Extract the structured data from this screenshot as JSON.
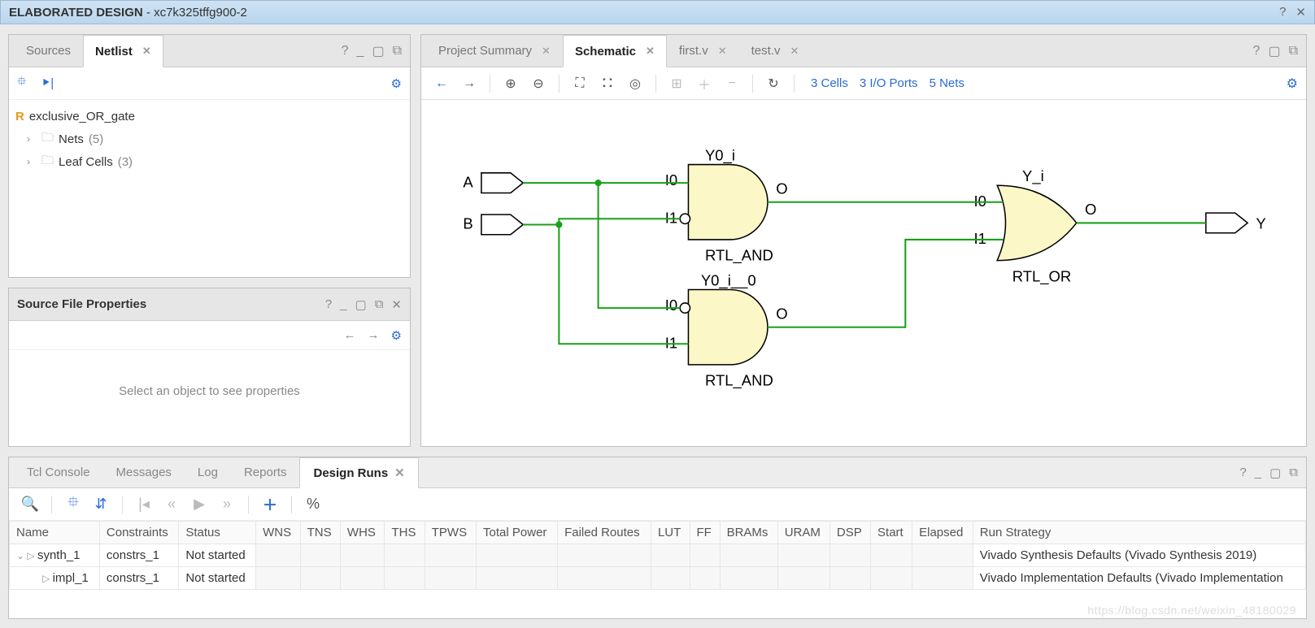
{
  "titlebar": {
    "label": "ELABORATED DESIGN",
    "subtitle": "xc7k325tffg900-2"
  },
  "left": {
    "tabs": {
      "sources": "Sources",
      "netlist": "Netlist"
    },
    "tree": {
      "root": "exclusive_OR_gate",
      "nets_label": "Nets",
      "nets_count": "(5)",
      "cells_label": "Leaf Cells",
      "cells_count": "(3)"
    },
    "props": {
      "title": "Source File Properties",
      "placeholder": "Select an object to see properties"
    }
  },
  "schematic": {
    "tabs": {
      "project": "Project Summary",
      "schematic": "Schematic",
      "first": "first.v",
      "test": "test.v"
    },
    "info": {
      "cells": "3 Cells",
      "io": "3 I/O Ports",
      "nets": "5 Nets"
    },
    "ports": {
      "a": "A",
      "b": "B",
      "y": "Y"
    },
    "gates": {
      "g1": {
        "name": "Y0_i",
        "type": "RTL_AND",
        "i0": "I0",
        "i1": "I1",
        "o": "O"
      },
      "g2": {
        "name": "Y0_i__0",
        "type": "RTL_AND",
        "i0": "I0",
        "i1": "I1",
        "o": "O"
      },
      "g3": {
        "name": "Y_i",
        "type": "RTL_OR",
        "i0": "I0",
        "i1": "I1",
        "o": "O"
      }
    }
  },
  "bottom": {
    "tabs": {
      "tcl": "Tcl Console",
      "messages": "Messages",
      "log": "Log",
      "reports": "Reports",
      "runs": "Design Runs"
    },
    "cols": {
      "name": "Name",
      "constraints": "Constraints",
      "status": "Status",
      "wns": "WNS",
      "tns": "TNS",
      "whs": "WHS",
      "ths": "THS",
      "tpws": "TPWS",
      "power": "Total Power",
      "failed": "Failed Routes",
      "lut": "LUT",
      "ff": "FF",
      "brams": "BRAMs",
      "uram": "URAM",
      "dsp": "DSP",
      "start": "Start",
      "elapsed": "Elapsed",
      "strategy": "Run Strategy"
    },
    "rows": [
      {
        "name": "synth_1",
        "constraints": "constrs_1",
        "status": "Not started",
        "strategy": "Vivado Synthesis Defaults (Vivado Synthesis 2019)"
      },
      {
        "name": "impl_1",
        "constraints": "constrs_1",
        "status": "Not started",
        "strategy": "Vivado Implementation Defaults (Vivado Implementation"
      }
    ]
  },
  "watermark": "https://blog.csdn.net/weixin_48180029"
}
